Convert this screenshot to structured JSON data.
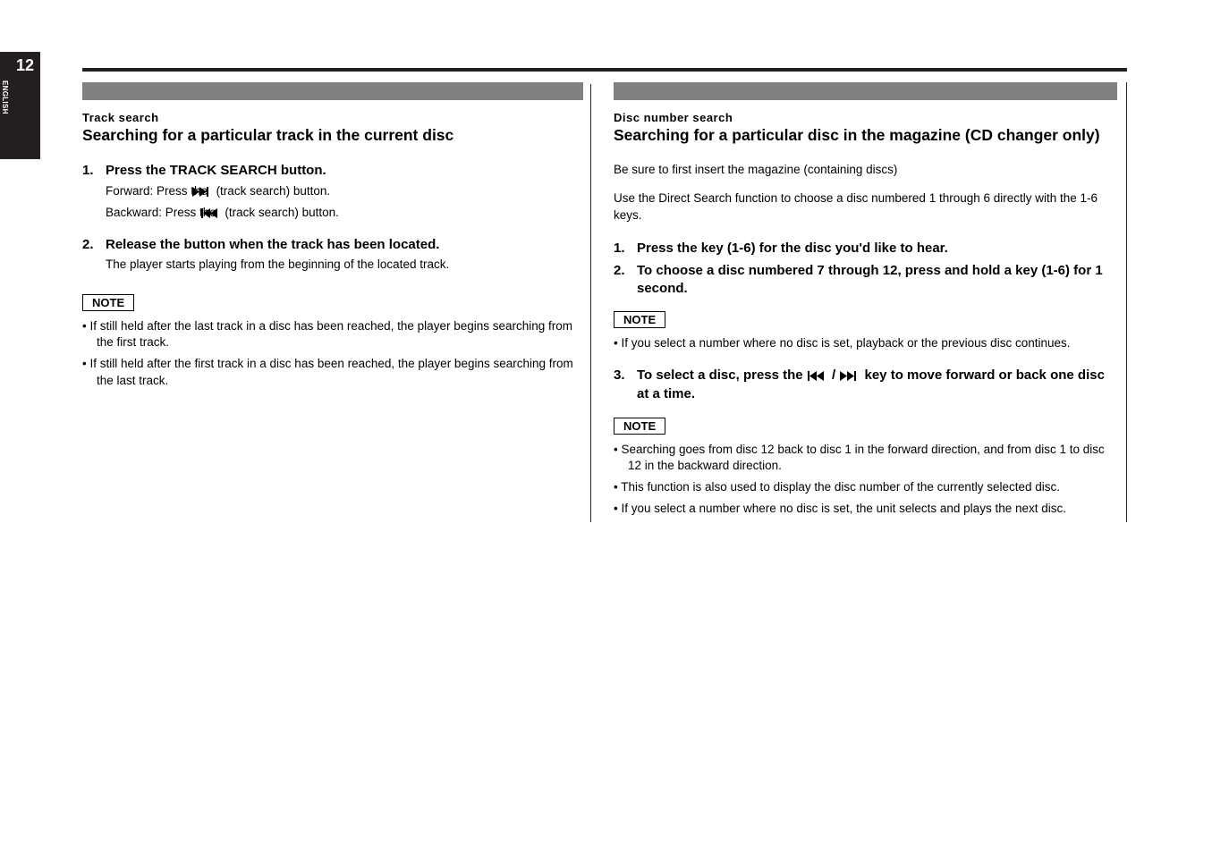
{
  "page_number": "12",
  "tab_label": "ENGLISH",
  "left": {
    "bar": "",
    "section_label": "Track search",
    "section_title": "Searching for a particular track in the current disc",
    "steps": [
      {
        "num": "1.",
        "text": "Press the TRACK SEARCH button.",
        "subs": [
          "Forward: Press the [FF_ICON] (track search) button.",
          "Backward: Press the [RW_ICON] (track search) button."
        ]
      },
      {
        "num": "2.",
        "text": "Release the button when the track has been located.",
        "subs": [
          "The player starts playing from the beginning of the located track."
        ]
      }
    ],
    "note_label": "NOTE",
    "notes": [
      "• If still held after the last track in a disc has been reached, the player begins searching from the first track.",
      "• If still held after the first track in a disc has been reached, the player begins searching from the last track."
    ]
  },
  "right": {
    "bar": "",
    "section_label": "Disc number search",
    "section_title": "Searching for a particular disc in the magazine (CD changer only)",
    "para1": "Be sure to first insert the magazine (containing discs)",
    "para2": "Use the Direct Search function to choose a disc numbered 1 through 6 directly with the 1-6 keys.",
    "steps": [
      {
        "num": "1.",
        "text": "Press the key (1-6) for the disc you'd like to hear."
      },
      {
        "num": "2.",
        "text": "To choose a disc numbered 7 through 12, press and hold a key (1-6) for 1 second."
      }
    ],
    "note1_label": "NOTE",
    "note1": "• If you select a number where no disc is set, playback or the previous disc continues.",
    "step3": {
      "num": "3.",
      "text": "To select a disc, press the [RW_ICON] / [FF_ICON] key to move forward or back one disc at a time."
    },
    "note2_label": "NOTE",
    "note2a": "• Searching goes from disc 12 back to disc 1 in the forward direction, and from disc 1 to disc 12 in the backward direction.",
    "note2b": "• This function is also used to display the disc number of the currently selected disc.",
    "note2c": "• If you select a number where no disc is set, the unit selects and plays the next disc."
  }
}
